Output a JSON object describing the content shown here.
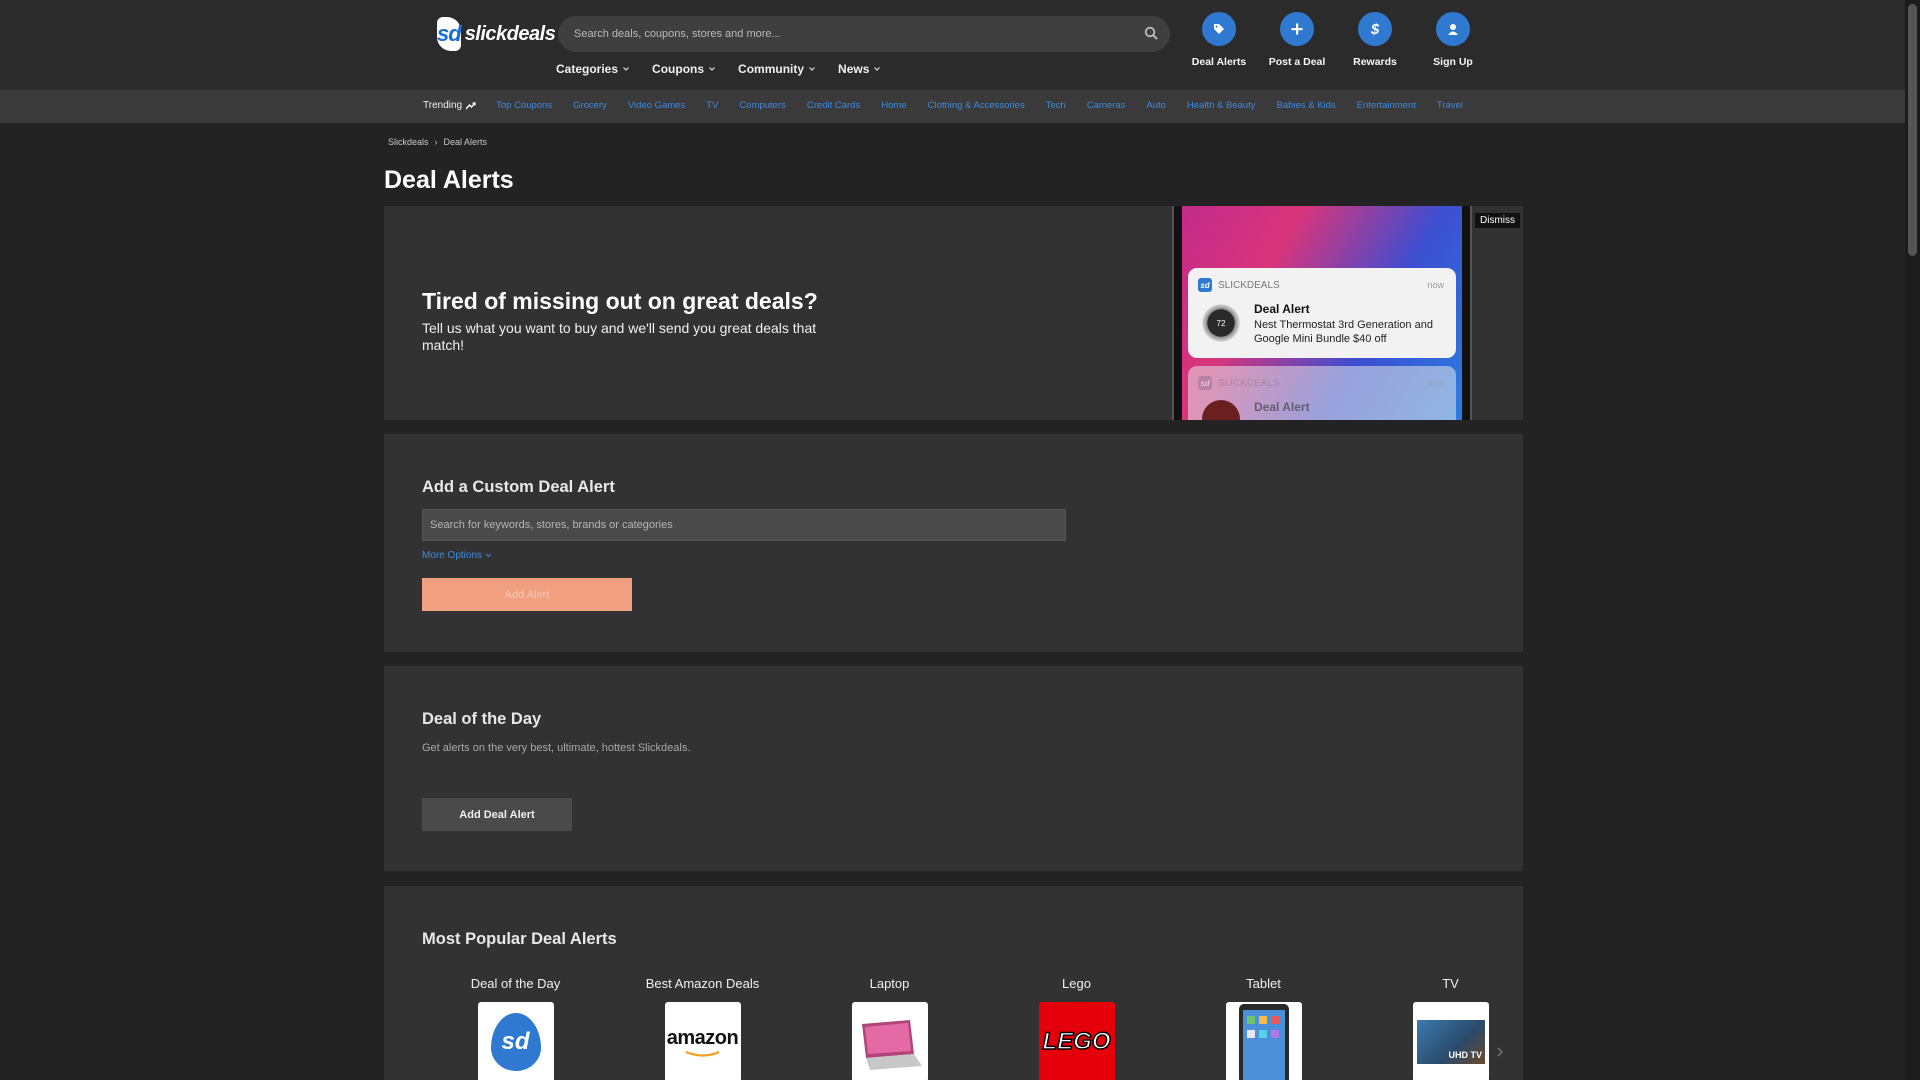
{
  "header": {
    "logo_text": "slickdeals",
    "logo_mark": "sd",
    "search_placeholder": "Search deals, coupons, stores and more...",
    "nav": [
      {
        "label": "Categories"
      },
      {
        "label": "Coupons"
      },
      {
        "label": "Community"
      },
      {
        "label": "News"
      }
    ],
    "actions": [
      {
        "label": "Deal Alerts",
        "icon": "tag-icon"
      },
      {
        "label": "Post a Deal",
        "icon": "plus-icon"
      },
      {
        "label": "Rewards",
        "icon": "dollar-icon"
      },
      {
        "label": "Sign Up",
        "icon": "user-icon"
      }
    ]
  },
  "subnav": {
    "trending_label": "Trending",
    "links": [
      "Top Coupons",
      "Grocery",
      "Video Games",
      "TV",
      "Computers",
      "Credit Cards",
      "Home",
      "Clothing & Accessories",
      "Tech",
      "Cameras",
      "Auto",
      "Health & Beauty",
      "Babies & Kids",
      "Entertainment",
      "Travel"
    ]
  },
  "breadcrumb": {
    "items": [
      "Slickdeals",
      "Deal Alerts"
    ],
    "separator": "›"
  },
  "page_title": "Deal Alerts",
  "hero": {
    "title": "Tired of missing out on great deals?",
    "subtitle": "Tell us what you want to buy and we'll send you great deals that match!",
    "dismiss_label": "Dismiss",
    "notification": {
      "app": "SLICKDEALS",
      "time": "now",
      "title": "Deal Alert",
      "body": "Nest Thermostat 3rd Generation and Google Mini Bundle $40 off",
      "thermostat_value": "72"
    },
    "notification2": {
      "app": "SLICKDEALS",
      "time": "now",
      "title": "Deal Alert"
    }
  },
  "custom_alert": {
    "title": "Add a Custom Deal Alert",
    "input_placeholder": "Search for keywords, stores, brands or categories",
    "more_options": "More Options",
    "button_label": "Add Alert"
  },
  "deal_of_day": {
    "title": "Deal of the Day",
    "description": "Get alerts on the very best, ultimate, hottest Slickdeals.",
    "button_label": "Add Deal Alert"
  },
  "popular": {
    "title": "Most Popular Deal Alerts",
    "items": [
      {
        "label": "Deal of the Day",
        "thumb": "sd"
      },
      {
        "label": "Best Amazon Deals",
        "thumb": "amazon"
      },
      {
        "label": "Laptop",
        "thumb": ""
      },
      {
        "label": "Lego",
        "thumb": "LEGO"
      },
      {
        "label": "Tablet",
        "thumb": ""
      },
      {
        "label": "TV",
        "thumb": "UHD TV"
      }
    ]
  },
  "colors": {
    "accent_blue": "#2f7ad0",
    "link_blue": "#3d8ae0",
    "add_alert_orange": "#f0a080",
    "background": "#232323",
    "card": "#323232"
  }
}
